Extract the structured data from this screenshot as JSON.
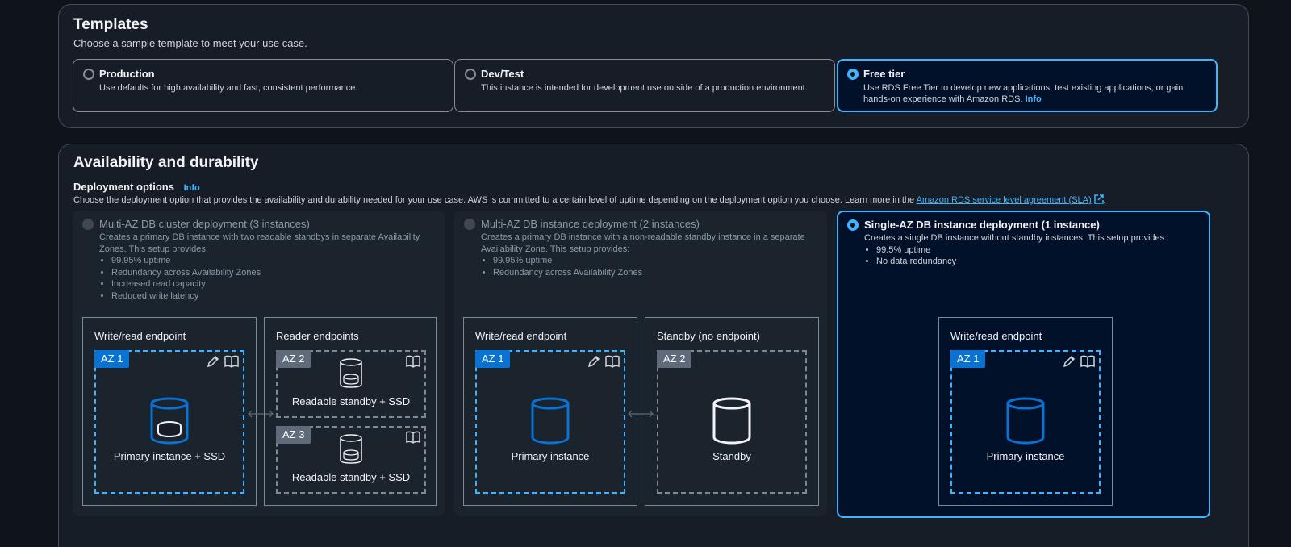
{
  "templates": {
    "title": "Templates",
    "description": "Choose a sample template to meet your use case.",
    "options": [
      {
        "title": "Production",
        "description": "Use defaults for high availability and fast, consistent performance.",
        "selected": false
      },
      {
        "title": "Dev/Test",
        "description": "This instance is intended for development use outside of a production environment.",
        "selected": false
      },
      {
        "title": "Free tier",
        "description": "Use RDS Free Tier to develop new applications, test existing applications, or gain hands-on experience with Amazon RDS.",
        "info": "Info",
        "selected": true
      }
    ]
  },
  "availability": {
    "title": "Availability and durability",
    "deployment_label": "Deployment options",
    "deployment_info": "Info",
    "description": "Choose the deployment option that provides the availability and durability needed for your use case. AWS is committed to a certain level of uptime depending on the deployment option you choose. Learn more in the",
    "sla_link": "Amazon RDS service level agreement (SLA)",
    "period": ".",
    "options": [
      {
        "title": "Multi-AZ DB cluster deployment (3 instances)",
        "description": "Creates a primary DB instance with two readable standbys in separate Availability Zones. This setup provides:",
        "bullets": [
          "99.95% uptime",
          "Redundancy across Availability Zones",
          "Increased read capacity",
          "Reduced write latency"
        ],
        "left_box": {
          "title": "Write/read endpoint",
          "az": "AZ 1",
          "label": "Primary instance + SSD"
        },
        "right_box": {
          "title": "Reader endpoints",
          "az_a": "AZ 2",
          "label_a": "Readable standby + SSD",
          "az_b": "AZ 3",
          "label_b": "Readable standby + SSD"
        }
      },
      {
        "title": "Multi-AZ DB instance deployment (2 instances)",
        "description": "Creates a primary DB instance with a non-readable standby instance in a separate Availability Zone. This setup provides:",
        "bullets": [
          "99.95% uptime",
          "Redundancy across Availability Zones"
        ],
        "left_box": {
          "title": "Write/read endpoint",
          "az": "AZ 1",
          "label": "Primary instance"
        },
        "right_box": {
          "title": "Standby (no endpoint)",
          "az": "AZ 2",
          "label": "Standby"
        }
      },
      {
        "title": "Single-AZ DB instance deployment (1 instance)",
        "description": "Creates a single DB instance without standby instances. This setup provides:",
        "bullets": [
          "99.5% uptime",
          "No data redundancy"
        ],
        "box": {
          "title": "Write/read endpoint",
          "az": "AZ 1",
          "label": "Primary instance"
        },
        "selected": true
      }
    ]
  },
  "colors": {
    "accent": "#42b4ff",
    "badge_blue": "#0972d3",
    "badge_grey": "#5f6b7a",
    "background": "#0f141a",
    "panel": "#161d26"
  }
}
